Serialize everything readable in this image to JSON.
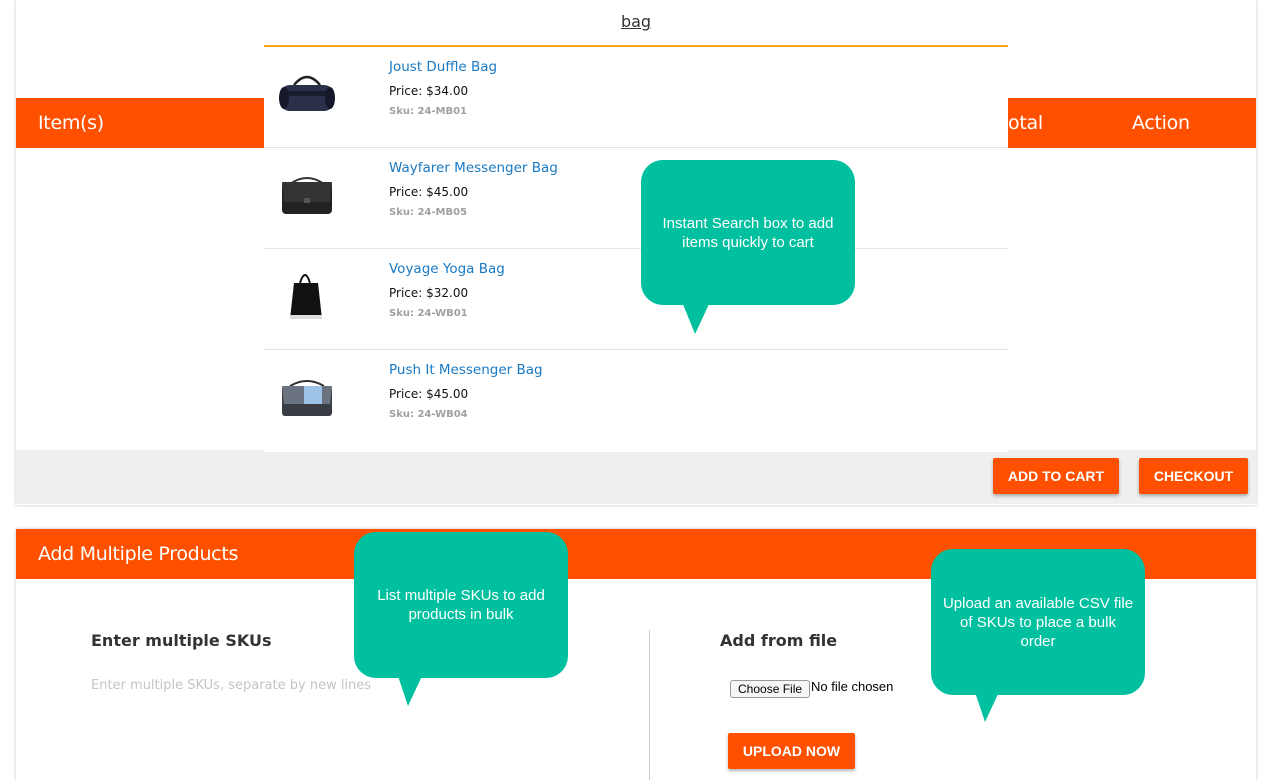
{
  "search": {
    "query": "bag"
  },
  "cart_table": {
    "headers": {
      "items": "Item(s)",
      "total": "otal",
      "action": "Action"
    }
  },
  "results": [
    {
      "name": "Joust Duffle Bag",
      "price": "Price: $34.00",
      "sku": "Sku: 24-MB01",
      "icon": "duffle-bag-icon"
    },
    {
      "name": "Wayfarer Messenger Bag",
      "price": "Price: $45.00",
      "sku": "Sku: 24-MB05",
      "icon": "messenger-bag-icon"
    },
    {
      "name": "Voyage Yoga Bag",
      "price": "Price: $32.00",
      "sku": "Sku: 24-WB01",
      "icon": "tote-bag-icon"
    },
    {
      "name": "Push It Messenger Bag",
      "price": "Price: $45.00",
      "sku": "Sku: 24-WB04",
      "icon": "messenger-bag-icon"
    }
  ],
  "actions": {
    "add_to_cart": "ADD TO CART",
    "checkout": "CHECKOUT"
  },
  "multi": {
    "header": "Add Multiple Products",
    "skus_title": "Enter multiple SKUs",
    "skus_placeholder": "Enter multiple SKUs, separate by new lines",
    "file_title": "Add from file",
    "choose_file": "Choose File",
    "no_file": "No file chosen",
    "upload": "UPLOAD NOW"
  },
  "callouts": {
    "search": "Instant Search box to add items quickly to cart",
    "multi": "List multiple SKUs to add products in bulk",
    "csv": "Upload an available CSV file of SKUs to place a bulk order"
  },
  "colors": {
    "accent": "#ff5000",
    "callout": "#00c0a0",
    "search_underline": "#f4a623",
    "link": "#1979c3"
  }
}
